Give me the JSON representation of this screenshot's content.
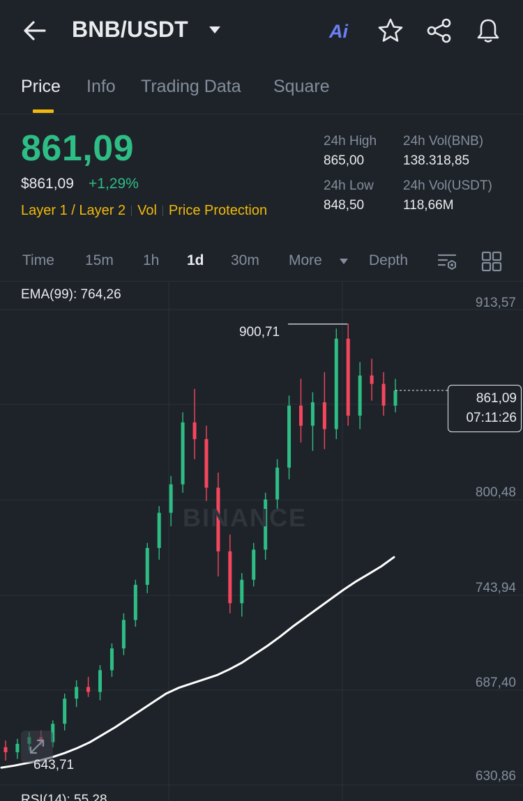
{
  "header": {
    "pair": "BNB/USDT",
    "ai_label": "Ai"
  },
  "tabs": [
    {
      "label": "Price",
      "active": true
    },
    {
      "label": "Info",
      "active": false
    },
    {
      "label": "Trading Data",
      "active": false
    },
    {
      "label": "Square",
      "active": false
    }
  ],
  "price": {
    "last": "861,09",
    "usd": "$861,09",
    "change": "+1,29%",
    "tags": [
      "Layer 1 / Layer 2",
      "Vol",
      "Price Protection"
    ]
  },
  "stats": {
    "high_label": "24h High",
    "high_value": "865,00",
    "low_label": "24h Low",
    "low_value": "848,50",
    "vol_bnb_label": "24h Vol(BNB)",
    "vol_bnb_value": "138.318,85",
    "vol_usdt_label": "24h Vol(USDT)",
    "vol_usdt_value": "118,66M"
  },
  "intervals": [
    {
      "label": "Time",
      "active": false
    },
    {
      "label": "15m",
      "active": false
    },
    {
      "label": "1h",
      "active": false
    },
    {
      "label": "1d",
      "active": true
    },
    {
      "label": "30m",
      "active": false
    },
    {
      "label": "More",
      "active": false
    },
    {
      "label": "Depth",
      "active": false
    }
  ],
  "chart": {
    "ema_label": "EMA(99): 764,26",
    "rsi_label": "RSI(14): 55,28",
    "current_price": "861,09",
    "countdown": "07:11:26",
    "high_marker": "900,71",
    "low_marker": "643,71",
    "watermark": "BINANCE",
    "axis": [
      "913,57",
      "800,48",
      "743,94",
      "687,40",
      "630,86"
    ]
  },
  "colors": {
    "up": "#2ebd85",
    "down": "#f6465d",
    "accent": "#f0b90b",
    "bg": "#1e2329"
  },
  "chart_data": {
    "type": "candlestick",
    "ylim": [
      630.86,
      913.57
    ],
    "yticks": [
      913.57,
      800.48,
      743.94,
      687.4,
      630.86
    ],
    "last_price": 861.09,
    "high": 900.71,
    "low": 643.71,
    "ema99": [
      635.8,
      637.0,
      638.5,
      640.0,
      642.0,
      644.5,
      647.5,
      651.0,
      655.5,
      660.0,
      665.0,
      670.0,
      675.0,
      680.0,
      683.5,
      686.0,
      688.5,
      691.0,
      694.5,
      698.5,
      703.5,
      708.5,
      714.0,
      720.0,
      725.5,
      731.0,
      736.5,
      742.0,
      747.0,
      751.5,
      756.0,
      761.5
    ],
    "ohlc": [
      [
        648,
        652,
        640,
        645
      ],
      [
        645,
        653,
        641,
        650
      ],
      [
        650,
        657,
        646,
        654
      ],
      [
        654,
        658,
        649,
        651
      ],
      [
        651,
        664,
        648,
        662
      ],
      [
        662,
        680,
        658,
        677
      ],
      [
        677,
        688,
        672,
        684
      ],
      [
        684,
        690,
        678,
        681
      ],
      [
        681,
        697,
        676,
        694
      ],
      [
        694,
        710,
        690,
        707
      ],
      [
        707,
        728,
        703,
        724
      ],
      [
        724,
        748,
        720,
        745
      ],
      [
        745,
        770,
        740,
        767
      ],
      [
        767,
        792,
        760,
        788
      ],
      [
        788,
        810,
        780,
        805
      ],
      [
        805,
        848,
        800,
        842
      ],
      [
        842,
        862,
        820,
        832
      ],
      [
        832,
        840,
        795,
        803
      ],
      [
        803,
        812,
        750,
        765
      ],
      [
        765,
        775,
        728,
        734
      ],
      [
        734,
        752,
        726,
        748
      ],
      [
        748,
        770,
        744,
        766
      ],
      [
        766,
        800,
        760,
        796
      ],
      [
        796,
        820,
        790,
        815
      ],
      [
        815,
        858,
        808,
        852
      ],
      [
        852,
        868,
        830,
        840
      ],
      [
        840,
        860,
        825,
        854
      ],
      [
        854,
        872,
        826,
        838
      ],
      [
        838,
        898,
        832,
        892
      ],
      [
        892,
        901,
        840,
        846
      ],
      [
        846,
        878,
        838,
        870
      ],
      [
        870,
        880,
        855,
        865
      ],
      [
        865,
        872,
        846,
        852
      ],
      [
        852,
        868,
        848,
        861
      ]
    ]
  }
}
